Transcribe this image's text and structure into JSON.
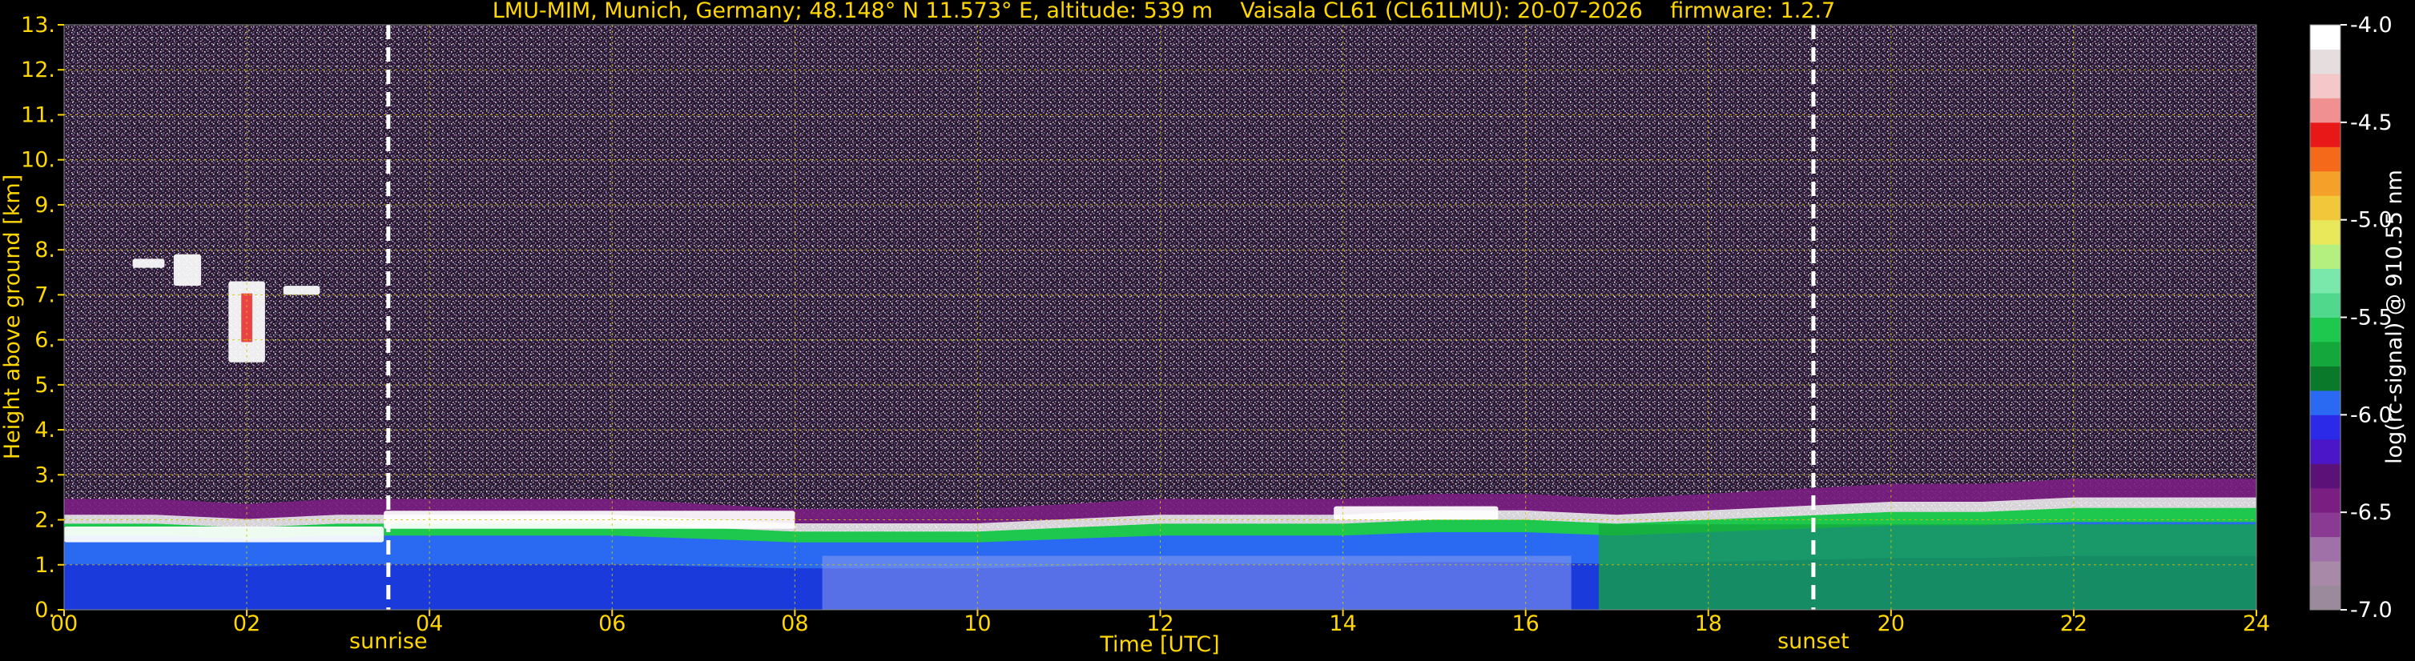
{
  "chart_data": {
    "type": "heatmap",
    "title": "LMU-MIM, Munich, Germany; 48.148° N 11.573° E, altitude: 539 m    Vaisala CL61 (CL61LMU): 20-07-2026    firmware: 1.2.7",
    "xlabel": "Time [UTC]",
    "ylabel": "Height above ground [km]",
    "xlim": [
      0,
      24
    ],
    "ylim": [
      0,
      13
    ],
    "x_ticks": [
      "00",
      "02",
      "04",
      "06",
      "08",
      "10",
      "12",
      "14",
      "16",
      "18",
      "20",
      "22",
      "24"
    ],
    "y_ticks": [
      "0.",
      "1.",
      "2.",
      "3.",
      "4.",
      "5.",
      "6.",
      "7.",
      "8.",
      "9.",
      "10.",
      "11.",
      "12.",
      "13."
    ],
    "grid": true,
    "markers": [
      {
        "label": "sunrise",
        "x": 3.55
      },
      {
        "label": "sunset",
        "x": 19.15
      }
    ],
    "colorbar": {
      "label": "log(rc-signal) @ 910.55 nm",
      "range": [
        -7.0,
        -4.0
      ],
      "ticks": [
        "-7.0",
        "-6.5",
        "-6.0",
        "-5.5",
        "-5.0",
        "-4.5",
        "-4.0"
      ],
      "colors": [
        "#9a8a9c",
        "#a889a8",
        "#a070a8",
        "#8a3a92",
        "#7a1e82",
        "#5a1178",
        "#4a16c8",
        "#2a2ae8",
        "#2a6af2",
        "#0a7a2a",
        "#14a83c",
        "#1ec84e",
        "#50d88c",
        "#7ae8aa",
        "#b4f080",
        "#e8e85a",
        "#f2c83a",
        "#f5a028",
        "#f56a1a",
        "#e81818",
        "#f09090",
        "#f4c8c8",
        "#e6dede",
        "#ffffff"
      ]
    },
    "layers": {
      "aerosol_top_km": [
        2.2,
        2.2,
        2.1,
        2.2,
        2.2,
        2.2,
        2.2,
        2.1,
        2.0,
        2.0,
        2.0,
        2.1,
        2.2,
        2.2,
        2.2,
        2.3,
        2.3,
        2.2,
        2.3,
        2.4,
        2.5,
        2.5,
        2.6,
        2.6,
        2.6
      ],
      "cloud_patches": [
        {
          "t0": 0.75,
          "t1": 1.1,
          "z0": 7.6,
          "z1": 7.8
        },
        {
          "t0": 1.2,
          "t1": 1.5,
          "z0": 7.2,
          "z1": 7.9
        },
        {
          "t0": 1.8,
          "t1": 2.2,
          "z0": 5.5,
          "z1": 7.3
        },
        {
          "t0": 2.4,
          "t1": 2.8,
          "z0": 7.0,
          "z1": 7.2
        },
        {
          "t0": 0.0,
          "t1": 3.5,
          "z0": 1.5,
          "z1": 1.85
        },
        {
          "t0": 3.5,
          "t1": 8.0,
          "z0": 1.8,
          "z1": 2.2
        },
        {
          "t0": 13.9,
          "t1": 15.7,
          "z0": 2.0,
          "z1": 2.3
        }
      ]
    }
  }
}
